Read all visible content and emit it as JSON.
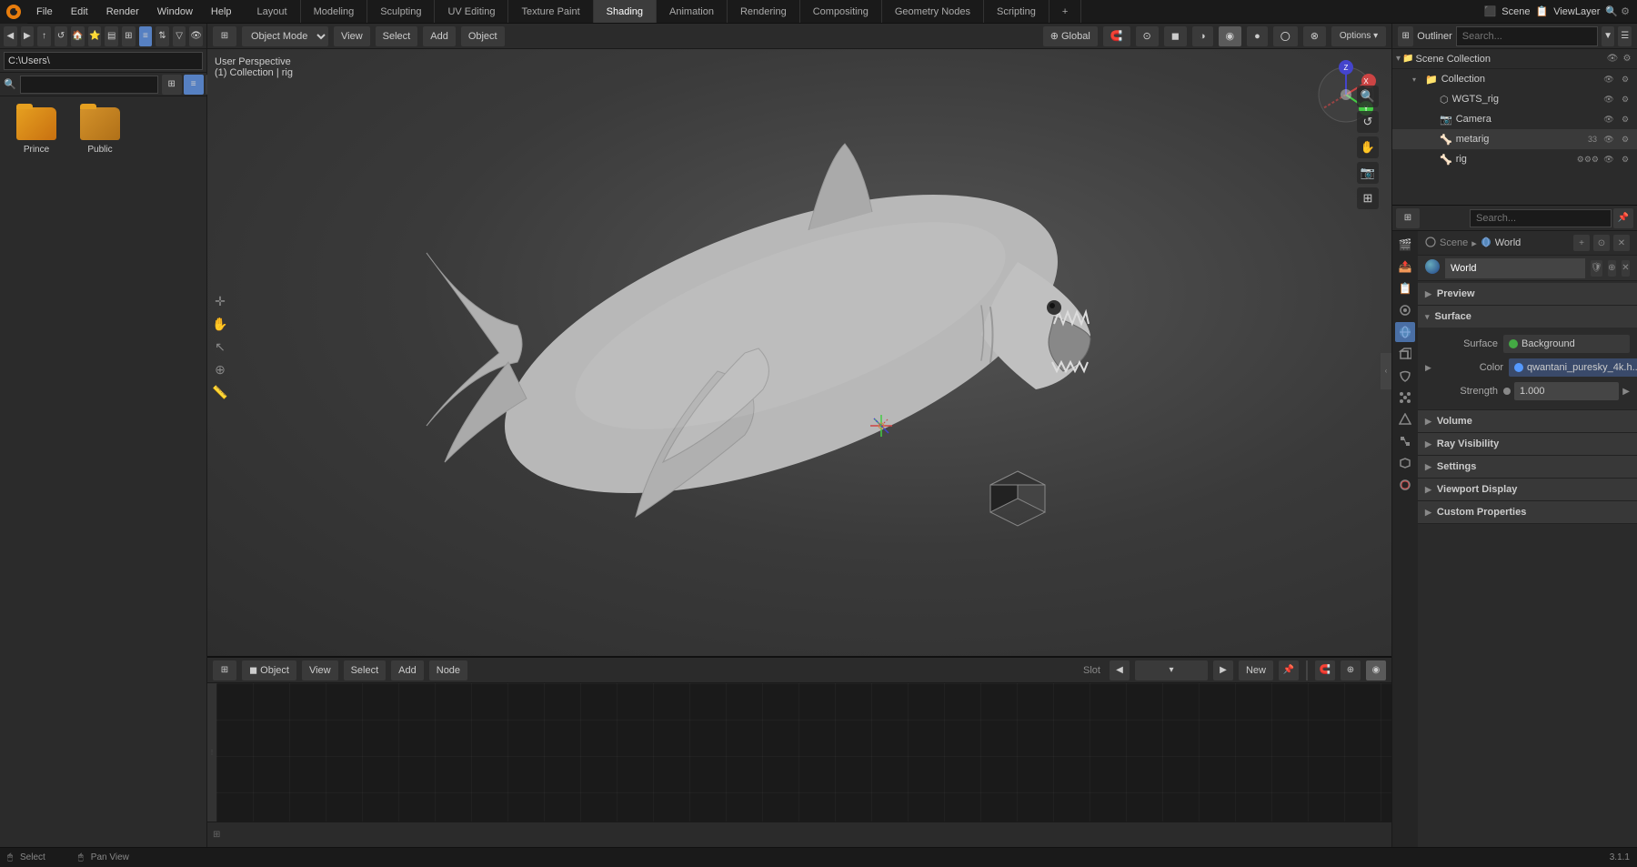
{
  "app": {
    "name": "Blender",
    "version": "3.1.1"
  },
  "top_menu": {
    "items": [
      "File",
      "Edit",
      "Render",
      "Window",
      "Help"
    ],
    "workspaces": [
      "Layout",
      "Modeling",
      "Sculpting",
      "UV Editing",
      "Texture Paint",
      "Shading",
      "Animation",
      "Rendering",
      "Compositing",
      "Geometry Nodes",
      "Scripting"
    ],
    "active_workspace": "Shading",
    "scene_name": "Scene",
    "view_layer": "ViewLayer"
  },
  "left_panel": {
    "path": "C:\\Users\\",
    "search_placeholder": "",
    "files": [
      {
        "name": "Prince",
        "type": "folder"
      },
      {
        "name": "Public",
        "type": "folder"
      }
    ]
  },
  "viewport": {
    "mode": "Object Mode",
    "perspective": "User Perspective",
    "collection": "(1) Collection | rig",
    "global_transform": "Global",
    "header_buttons": [
      "View",
      "Select",
      "Add",
      "Object"
    ],
    "bottom_buttons": [
      "View",
      "Select",
      "Add",
      "Node"
    ],
    "object_mode": "Object",
    "slot": "Slot",
    "select_label": "Select",
    "pan_view_label": "Pan View"
  },
  "outliner": {
    "title": "Scene Collection",
    "collection_name": "Collection",
    "items": [
      {
        "name": "WGTS_rig",
        "type": "mesh",
        "indent": 1
      },
      {
        "name": "Camera",
        "type": "camera",
        "indent": 1
      },
      {
        "name": "metarig",
        "type": "armature",
        "indent": 1
      },
      {
        "name": "rig",
        "type": "armature",
        "indent": 1
      }
    ]
  },
  "properties": {
    "breadcrumb_scene": "Scene",
    "breadcrumb_world": "World",
    "world_name": "World",
    "sections": {
      "preview": {
        "label": "Preview",
        "expanded": false
      },
      "surface": {
        "label": "Surface",
        "expanded": true,
        "surface_label": "Surface",
        "surface_value": "Background",
        "color_label": "Color",
        "color_value": "qwantani_puresky_4k.h...",
        "color_dot": "#5599ff",
        "strength_label": "Strength",
        "strength_value": "1.000",
        "strength_dot": "#888888"
      },
      "volume": {
        "label": "Volume",
        "expanded": false
      },
      "ray_visibility": {
        "label": "Ray Visibility",
        "expanded": false
      },
      "settings": {
        "label": "Settings",
        "expanded": false
      },
      "viewport_display": {
        "label": "Viewport Display",
        "expanded": false
      },
      "custom_properties": {
        "label": "Custom Properties",
        "expanded": false
      }
    },
    "icon_sidebar": [
      {
        "icon": "🎬",
        "name": "render-properties",
        "active": false
      },
      {
        "icon": "📤",
        "name": "output-properties",
        "active": false
      },
      {
        "icon": "📷",
        "name": "view-layer-properties",
        "active": false
      },
      {
        "icon": "🌍",
        "name": "scene-properties",
        "active": false
      },
      {
        "icon": "🌐",
        "name": "world-properties",
        "active": true
      },
      {
        "icon": "🔧",
        "name": "object-properties",
        "active": false
      },
      {
        "icon": "✏️",
        "name": "modifier-properties",
        "active": false
      },
      {
        "icon": "🔗",
        "name": "particles-properties",
        "active": false
      },
      {
        "icon": "🌀",
        "name": "physics-properties",
        "active": false
      },
      {
        "icon": "📦",
        "name": "constraints-properties",
        "active": false
      },
      {
        "icon": "📐",
        "name": "data-properties",
        "active": false
      },
      {
        "icon": "🎨",
        "name": "material-properties",
        "active": false
      }
    ]
  },
  "status_bar": {
    "select": "Select",
    "pan_view": "Pan View",
    "version": "3.1.1"
  }
}
